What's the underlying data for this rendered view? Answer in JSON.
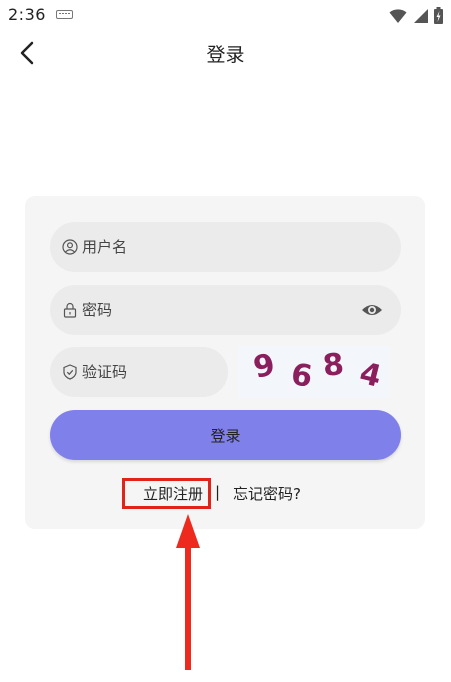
{
  "status_bar": {
    "time": "2:36",
    "icons": [
      "keyboard-icon",
      "wifi-icon",
      "signal-icon",
      "battery-charging-icon"
    ]
  },
  "header": {
    "title": "登录",
    "back_icon": "chevron-left-icon"
  },
  "form": {
    "username_placeholder": "用户名",
    "password_placeholder": "密码",
    "captcha_placeholder": "验证码",
    "captcha_text": "9684",
    "login_label": "登录"
  },
  "links": {
    "register": "立即注册",
    "separator": "|",
    "forgot": "忘记密码?"
  },
  "colors": {
    "login_button": "#8080ea",
    "card_bg": "#f5f5f5",
    "field_bg": "#ebebeb",
    "captcha_char": "#8b1e5d",
    "annotation": "#e2231a"
  }
}
